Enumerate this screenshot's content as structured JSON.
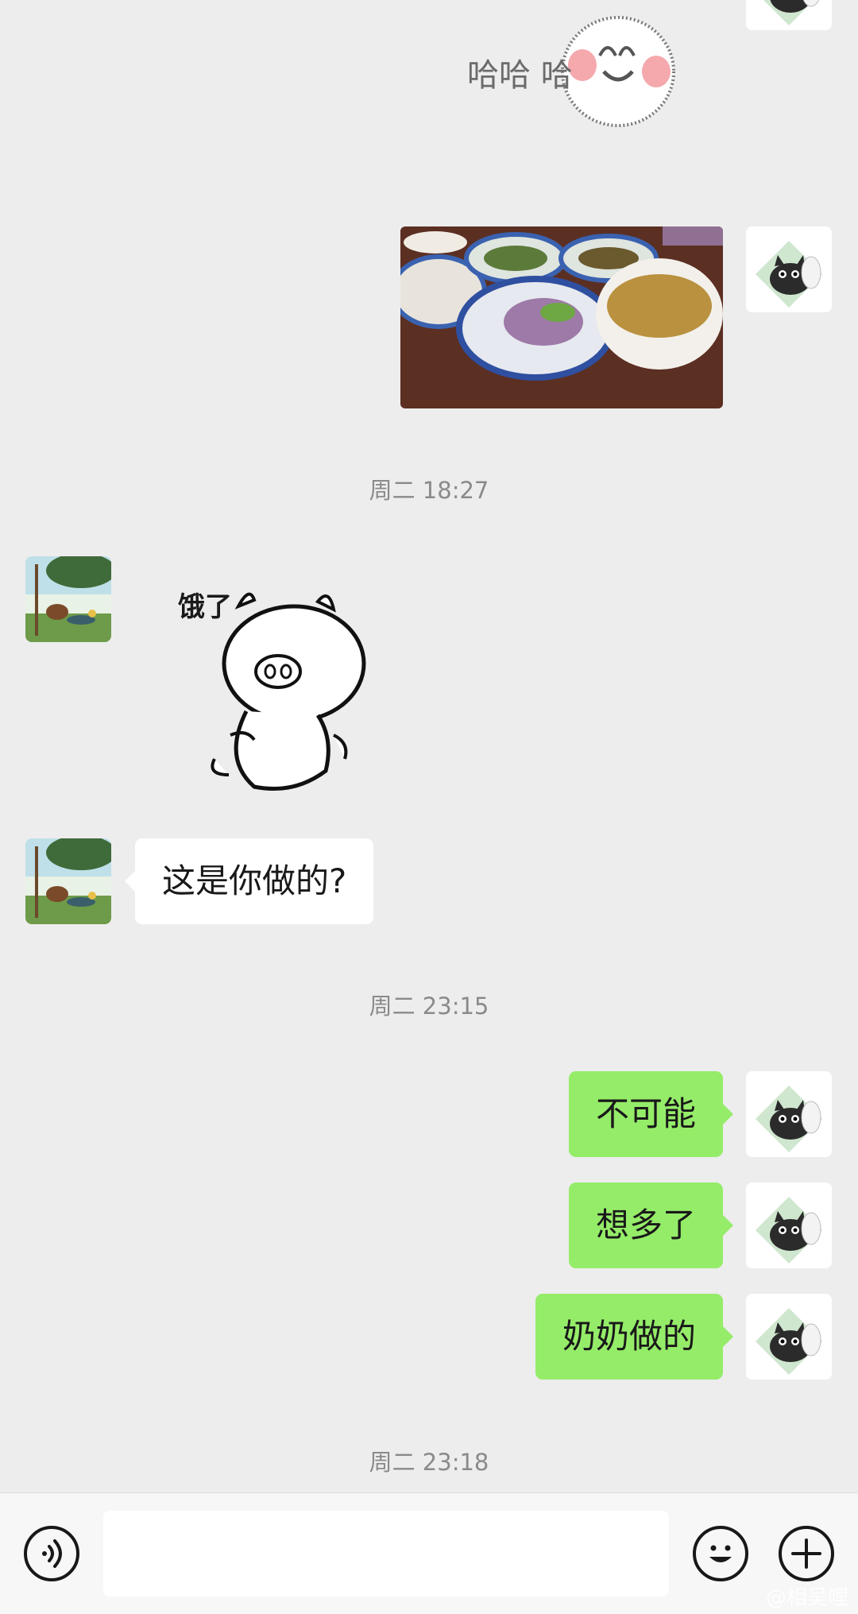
{
  "conversation": {
    "timestamps": [
      "周二 18:27",
      "周二 23:15",
      "周二 23:18"
    ],
    "messages": [
      {
        "sender": "self",
        "type": "sticker",
        "sticker_text": "哈哈 哈"
      },
      {
        "sender": "self",
        "type": "photo",
        "description": ""
      },
      {
        "sender": "other",
        "type": "sticker",
        "sticker_text": "饿了"
      },
      {
        "sender": "other",
        "type": "text",
        "text": "这是你做的?"
      },
      {
        "sender": "self",
        "type": "text",
        "text": "不可能"
      },
      {
        "sender": "self",
        "type": "text",
        "text": "想多了"
      },
      {
        "sender": "self",
        "type": "text",
        "text": "奶奶做的"
      }
    ]
  },
  "input_bar": {
    "voice_icon": "voice-icon",
    "emoji_icon": "emoji-icon",
    "plus_icon": "plus-icon",
    "text_value": ""
  },
  "watermark": "@相吴哩",
  "colors": {
    "background": "#ededed",
    "outgoing_bubble": "#95ec69",
    "incoming_bubble": "#ffffff",
    "timestamp_text": "#8a8a8a"
  }
}
